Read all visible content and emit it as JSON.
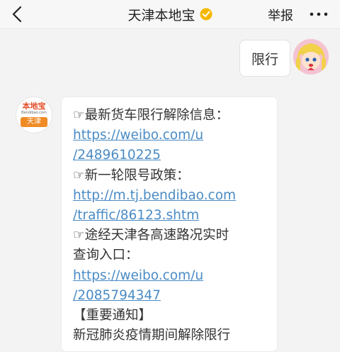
{
  "header": {
    "title": "天津本地宝",
    "report_label": "举报",
    "back_icon": "chevron-left-icon",
    "verified_icon": "verified-badge-icon",
    "more_icon": "more-dots-icon",
    "verified_color": "#f5b700"
  },
  "messages": {
    "user_message": "限行",
    "bot": {
      "avatar_logo": "本地宝",
      "avatar_subtitle": "Bendibao.com",
      "avatar_city": "天津",
      "lines": [
        "☞最新货车限行解除信息：",
        "https://weibo.com/u",
        "/2489610225",
        "☞新一轮限号政策：",
        "http://m.tj.bendibao.com",
        "/traffic/86123.shtm",
        "☞途经天津各高速路况实时",
        "查询入口：",
        "https://weibo.com/u",
        "/2085794347",
        "【重要通知】",
        "新冠肺炎疫情期间解除限行"
      ]
    }
  },
  "colors": {
    "link": "#4a8bc5",
    "text": "#333333",
    "background": "#f3f3f3"
  }
}
